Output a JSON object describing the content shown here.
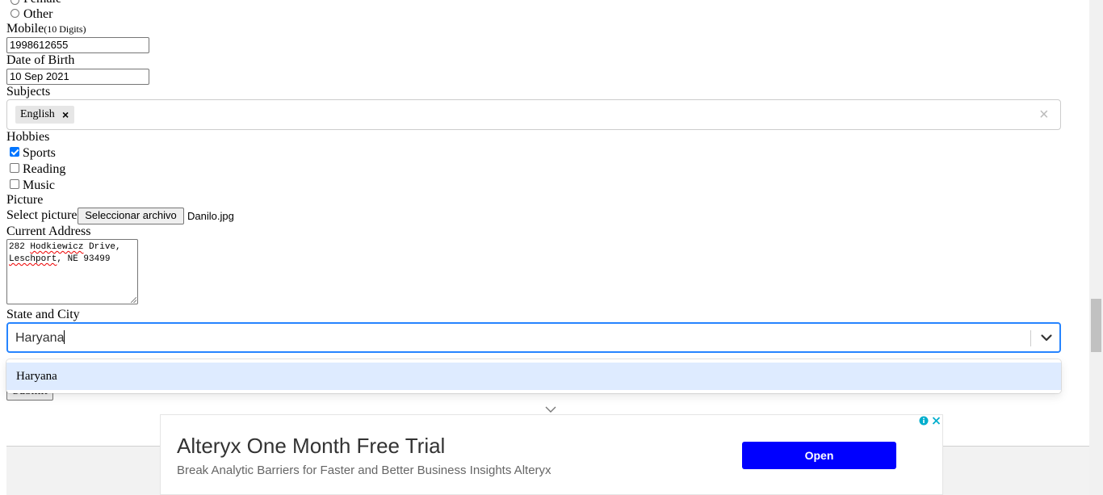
{
  "gender": {
    "female_label": "Female",
    "other_label": "Other"
  },
  "mobile": {
    "label": "Mobile",
    "hint": "(10 Digits)",
    "value": "1998612655"
  },
  "dob": {
    "label": "Date of Birth",
    "value": "10 Sep 2021"
  },
  "subjects": {
    "label": "Subjects",
    "chips": [
      "English"
    ],
    "chip_remove": "×",
    "clear": "×"
  },
  "hobbies": {
    "label": "Hobbies",
    "items": [
      {
        "label": "Sports",
        "checked": true
      },
      {
        "label": "Reading",
        "checked": false
      },
      {
        "label": "Music",
        "checked": false
      }
    ]
  },
  "picture": {
    "label": "Picture",
    "select_label": "Select picture",
    "button": "Seleccionar archivo",
    "filename": "Danilo.jpg"
  },
  "address": {
    "label": "Current Address",
    "line1_num": "282 ",
    "line1_word": "Hodkiewicz",
    "line1_rest": " Drive,",
    "line2_word": "Leschport",
    "line2_rest": ", NE 93499"
  },
  "state_city": {
    "label": "State and City",
    "input_value": "Haryana",
    "option": "Haryana"
  },
  "submit": {
    "label": "Submit"
  },
  "ad": {
    "title": "Alteryx One Month Free Trial",
    "subtitle": "Break Analytic Barriers for Faster and Better Business Insights Alteryx",
    "button": "Open",
    "info_glyph": "i",
    "close_glyph": "✕",
    "collapse_glyph": "⌄"
  },
  "colors": {
    "focus": "#2684ff",
    "option_highlight": "#deebff",
    "ad_button": "#0000ff",
    "checkbox": "#0075ff"
  }
}
